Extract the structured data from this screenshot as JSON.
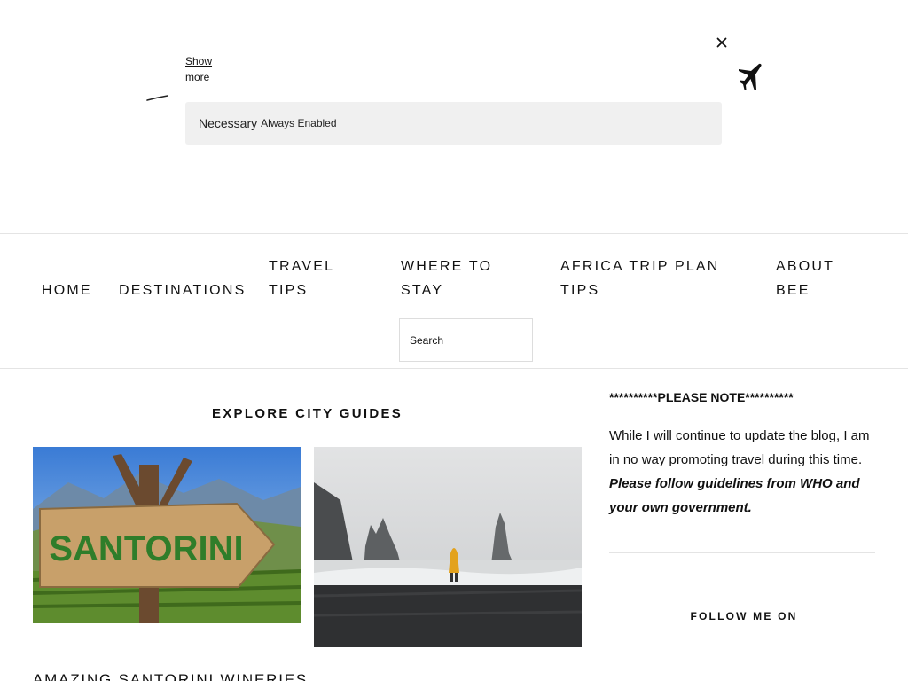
{
  "cookie_banner": {
    "show_more": "Show more",
    "necessary_label": "Necessary",
    "always_enabled": "Always Enabled",
    "close_icon": "close-icon",
    "plane_icon": "airplane-icon"
  },
  "nav": {
    "items": [
      {
        "line1": "HOME",
        "line2": ""
      },
      {
        "line1": "DESTINATIONS",
        "line2": ""
      },
      {
        "line1": "TRAVEL",
        "line2": "TIPS"
      },
      {
        "line1": "WHERE TO",
        "line2": "STAY"
      },
      {
        "line1": "AFRICA TRIP PLAN",
        "line2": "TIPS"
      },
      {
        "line1": "ABOUT",
        "line2": "BEE"
      }
    ],
    "search_placeholder": "Search"
  },
  "main": {
    "section_title": "EXPLORE CITY GUIDES",
    "card1_sign_text": "SANTORINI",
    "post_title": "AMAZING SANTORINI WINERIES"
  },
  "sidebar": {
    "note_heading": "**********PLEASE NOTE**********",
    "note_body": "While I will continue to update the blog, I am in no way promoting travel during this time.",
    "note_emphasis": "Please follow guidelines from WHO and your own government.",
    "follow_heading": "FOLLOW ME ON"
  },
  "colors": {
    "background": "#ffffff",
    "text": "#111111",
    "panel": "#f0f0f0",
    "divider": "#e4e4e4"
  }
}
